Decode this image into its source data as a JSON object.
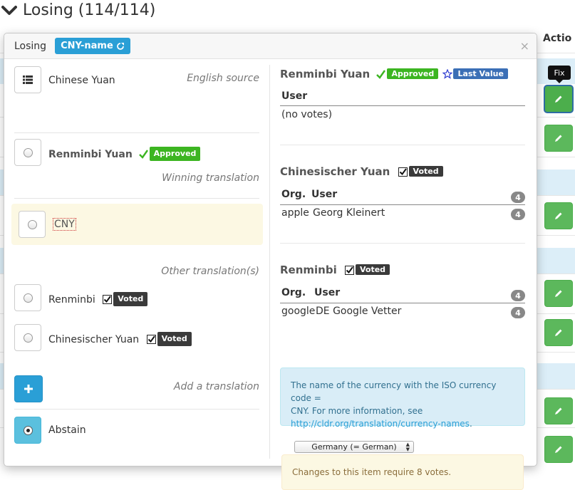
{
  "page": {
    "section_title": "Losing (114/114)",
    "action_header": "Actio",
    "tooltip": "Fix"
  },
  "popover": {
    "label": "Losing",
    "code": "CNY-name",
    "close": "×"
  },
  "left": {
    "english": {
      "value": "Chinese Yuan",
      "note": "English source"
    },
    "winning": {
      "value": "Renminbi Yuan",
      "badge": "Approved",
      "note": "Winning translation"
    },
    "missing": {
      "value": "CNY"
    },
    "other_note": "Other translation(s)",
    "others": [
      {
        "value": "Renminbi",
        "badge": "Voted"
      },
      {
        "value": "Chinesischer Yuan",
        "badge": "Voted"
      }
    ],
    "add_note": "Add a translation",
    "abstain": "Abstain"
  },
  "right": {
    "sections": [
      {
        "title": "Renminbi Yuan",
        "badge_approved": "Approved",
        "badge_last": "Last Value",
        "headers": {
          "user": "User"
        },
        "no_votes": "(no votes)"
      },
      {
        "title": "Chinesischer Yuan",
        "badge": "Voted",
        "headers": {
          "org": "Org.",
          "user": "User",
          "total": "4"
        },
        "row": {
          "org": "apple",
          "user": "Georg Kleinert",
          "votes": "4"
        }
      },
      {
        "title": "Renminbi",
        "badge": "Voted",
        "headers": {
          "org": "Org.",
          "user": "User",
          "total": "4"
        },
        "row": {
          "org": "google",
          "user": "DE Google Vetter",
          "votes": "4"
        }
      }
    ],
    "info": {
      "line1": "The name of the currency with the ISO currency code =",
      "line2": "CNY. For more information, see",
      "link": "http://cldr.org/translation/currency-names",
      "suffix": "."
    },
    "locale_select": "Germany (= German)",
    "warning": "Changes to this item require 8 votes."
  },
  "colors": {
    "accent": "#2a9fd6",
    "approved": "#3cb521",
    "fix_button": "#5cb85c",
    "warning_bg": "#fcf8e3",
    "info_bg": "#d9edf7"
  },
  "icons": [
    "chevron-down-icon",
    "external-link-icon",
    "list-icon",
    "pencil-icon",
    "plus-icon",
    "checkmark-icon",
    "checkbox-icon",
    "star-icon"
  ]
}
